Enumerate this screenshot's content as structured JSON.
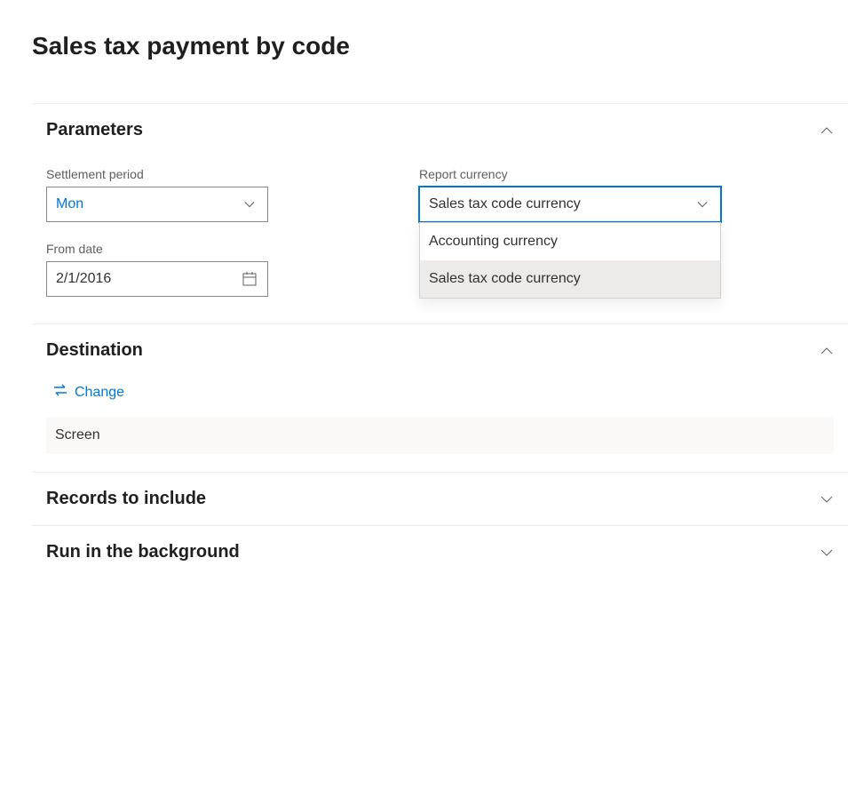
{
  "page_title": "Sales tax payment by code",
  "sections": {
    "parameters": {
      "title": "Parameters",
      "settlement_period": {
        "label": "Settlement period",
        "value": "Mon"
      },
      "from_date": {
        "label": "From date",
        "value": "2/1/2016"
      },
      "report_currency": {
        "label": "Report currency",
        "value": "Sales tax code currency",
        "options": [
          "Accounting currency",
          "Sales tax code currency"
        ]
      }
    },
    "destination": {
      "title": "Destination",
      "change_label": "Change",
      "value": "Screen"
    },
    "records": {
      "title": "Records to include"
    },
    "background": {
      "title": "Run in the background"
    }
  }
}
